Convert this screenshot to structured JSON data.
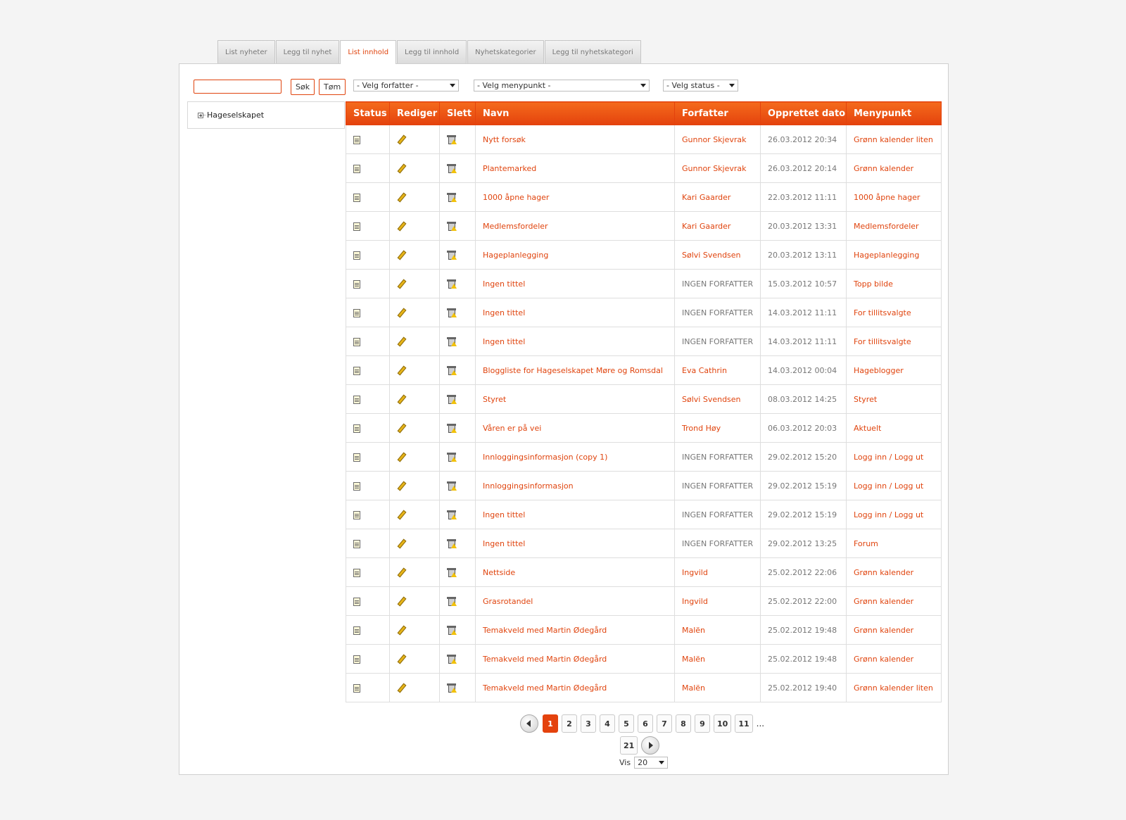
{
  "tabs": [
    {
      "label": "List nyheter"
    },
    {
      "label": "Legg til nyhet"
    },
    {
      "label": "List innhold"
    },
    {
      "label": "Legg til innhold"
    },
    {
      "label": "Nyhetskategorier"
    },
    {
      "label": "Legg til nyhetskategori"
    }
  ],
  "active_tab": "List innhold",
  "toolbar": {
    "search_value": "",
    "search_label": "Søk",
    "clear_label": "Tøm",
    "author_select": "- Velg forfatter -",
    "menu_select": "- Velg menypunkt -",
    "status_select": "- Velg status -"
  },
  "tree": {
    "root_label": "Hageselskapet"
  },
  "table": {
    "columns": [
      "Status",
      "Rediger",
      "Slett",
      "Navn",
      "Forfatter",
      "Opprettet dato",
      "Menypunkt"
    ],
    "rows": [
      {
        "name": "Nytt forsøk",
        "author": "Gunnor Skjevrak",
        "date": "26.03.2012 20:34",
        "menu": "Grønn kalender liten",
        "has_author": true
      },
      {
        "name": "Plantemarked",
        "author": "Gunnor Skjevrak",
        "date": "26.03.2012 20:14",
        "menu": "Grønn kalender",
        "has_author": true
      },
      {
        "name": "1000 åpne hager",
        "author": "Kari Gaarder",
        "date": "22.03.2012 11:11",
        "menu": "1000 åpne hager",
        "has_author": true
      },
      {
        "name": "Medlemsfordeler",
        "author": "Kari Gaarder",
        "date": "20.03.2012 13:31",
        "menu": "Medlemsfordeler",
        "has_author": true
      },
      {
        "name": "Hageplanlegging",
        "author": "Sølvi Svendsen",
        "date": "20.03.2012 13:11",
        "menu": "Hageplanlegging",
        "has_author": true
      },
      {
        "name": "Ingen tittel",
        "author": "INGEN FORFATTER",
        "date": "15.03.2012 10:57",
        "menu": "Topp bilde",
        "has_author": false
      },
      {
        "name": "Ingen tittel",
        "author": "INGEN FORFATTER",
        "date": "14.03.2012 11:11",
        "menu": "For tillitsvalgte",
        "has_author": false
      },
      {
        "name": "Ingen tittel",
        "author": "INGEN FORFATTER",
        "date": "14.03.2012 11:11",
        "menu": "For tillitsvalgte",
        "has_author": false
      },
      {
        "name": "Bloggliste for Hageselskapet Møre og Romsdal",
        "author": "Eva Cathrin",
        "date": "14.03.2012 00:04",
        "menu": "Hageblogger",
        "has_author": true
      },
      {
        "name": "Styret",
        "author": "Sølvi Svendsen",
        "date": "08.03.2012 14:25",
        "menu": "Styret",
        "has_author": true
      },
      {
        "name": "Våren er på vei",
        "author": "Trond Høy",
        "date": "06.03.2012 20:03",
        "menu": "Aktuelt",
        "has_author": true
      },
      {
        "name": "Innloggingsinformasjon (copy 1)",
        "author": "INGEN FORFATTER",
        "date": "29.02.2012 15:20",
        "menu": "Logg inn / Logg ut",
        "has_author": false
      },
      {
        "name": "Innloggingsinformasjon",
        "author": "INGEN FORFATTER",
        "date": "29.02.2012 15:19",
        "menu": "Logg inn / Logg ut",
        "has_author": false
      },
      {
        "name": "Ingen tittel",
        "author": "INGEN FORFATTER",
        "date": "29.02.2012 15:19",
        "menu": "Logg inn / Logg ut",
        "has_author": false
      },
      {
        "name": "Ingen tittel",
        "author": "INGEN FORFATTER",
        "date": "29.02.2012 13:25",
        "menu": "Forum",
        "has_author": false
      },
      {
        "name": "Nettside",
        "author": "Ingvild",
        "date": "25.02.2012 22:06",
        "menu": "Grønn kalender",
        "has_author": true
      },
      {
        "name": "Grasrotandel",
        "author": "Ingvild",
        "date": "25.02.2012 22:00",
        "menu": "Grønn kalender",
        "has_author": true
      },
      {
        "name": "Temakveld med Martin Ødegård",
        "author": "Malën",
        "date": "25.02.2012 19:48",
        "menu": "Grønn kalender",
        "has_author": true
      },
      {
        "name": "Temakveld med Martin Ødegård",
        "author": "Malën",
        "date": "25.02.2012 19:48",
        "menu": "Grønn kalender",
        "has_author": true
      },
      {
        "name": "Temakveld med Martin Ødegård",
        "author": "Malën",
        "date": "25.02.2012 19:40",
        "menu": "Grønn kalender liten",
        "has_author": true
      }
    ]
  },
  "pagination": {
    "pages": [
      "1",
      "2",
      "3",
      "4",
      "5",
      "6",
      "7",
      "8",
      "9",
      "10",
      "11"
    ],
    "current": "1",
    "ellipsis": "...",
    "last_page": "21",
    "page_size_label": "Vis",
    "page_size": "20"
  },
  "icons": {
    "status": "document-icon",
    "edit": "pencil-icon",
    "delete": "trash-warning-icon"
  },
  "colors": {
    "accent": "#e4420d",
    "muted_text": "#777777"
  }
}
